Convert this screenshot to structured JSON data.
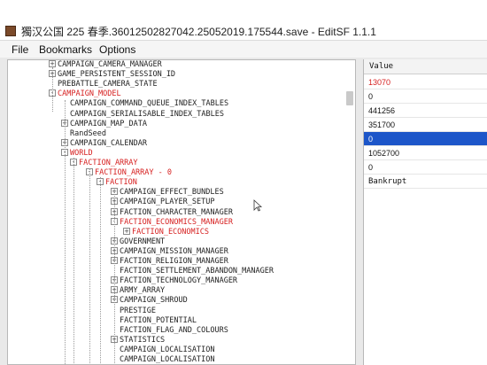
{
  "window": {
    "title": "獨汉公国 225 春季.36012502827042.25052019.175544.save - EditSF 1.1.1"
  },
  "menu": {
    "items": [
      "File",
      "Bookmarks",
      "Options"
    ]
  },
  "tree": {
    "rows": [
      {
        "label": "CAMPAIGN_CAMERA_MANAGER",
        "expander": "+",
        "red": false
      },
      {
        "label": "GAME_PERSISTENT_SESSION_ID",
        "expander": "+",
        "red": false
      },
      {
        "label": "PREBATTLE_CAMERA_STATE",
        "expander": "",
        "red": false
      },
      {
        "label": "CAMPAIGN_MODEL",
        "expander": "-",
        "red": true
      },
      {
        "label": "CAMPAIGN_COMMAND_QUEUE_INDEX_TABLES",
        "expander": "",
        "red": false
      },
      {
        "label": "CAMPAIGN_SERIALISABLE_INDEX_TABLES",
        "expander": "",
        "red": false
      },
      {
        "label": "CAMPAIGN_MAP_DATA",
        "expander": "+",
        "red": false
      },
      {
        "label": "RandSeed",
        "expander": "",
        "red": false
      },
      {
        "label": "CAMPAIGN_CALENDAR",
        "expander": "+",
        "red": false
      },
      {
        "label": "WORLD",
        "expander": "-",
        "red": true
      },
      {
        "label": "FACTION_ARRAY",
        "expander": "-",
        "red": true
      },
      {
        "label": "FACTION_ARRAY - 0",
        "expander": "-",
        "red": true
      },
      {
        "label": "FACTION",
        "expander": "-",
        "red": true
      },
      {
        "label": "CAMPAIGN_EFFECT_BUNDLES",
        "expander": "+",
        "red": false
      },
      {
        "label": "CAMPAIGN_PLAYER_SETUP",
        "expander": "+",
        "red": false
      },
      {
        "label": "FACTION_CHARACTER_MANAGER",
        "expander": "+",
        "red": false
      },
      {
        "label": "FACTION_ECONOMICS_MANAGER",
        "expander": "-",
        "red": true
      },
      {
        "label": "FACTION_ECONOMICS",
        "expander": "+",
        "red": true
      },
      {
        "label": "GOVERNMENT",
        "expander": "+",
        "red": false
      },
      {
        "label": "CAMPAIGN_MISSION_MANAGER",
        "expander": "+",
        "red": false
      },
      {
        "label": "FACTION_RELIGION_MANAGER",
        "expander": "+",
        "red": false
      },
      {
        "label": "FACTION_SETTLEMENT_ABANDON_MANAGER",
        "expander": "",
        "red": false
      },
      {
        "label": "FACTION_TECHNOLOGY_MANAGER",
        "expander": "+",
        "red": false
      },
      {
        "label": "ARMY_ARRAY",
        "expander": "+",
        "red": false
      },
      {
        "label": "CAMPAIGN_SHROUD",
        "expander": "+",
        "red": false
      },
      {
        "label": "PRESTIGE",
        "expander": "",
        "red": false
      },
      {
        "label": "FACTION_POTENTIAL",
        "expander": "",
        "red": false
      },
      {
        "label": "FACTION_FLAG_AND_COLOURS",
        "expander": "",
        "red": false
      },
      {
        "label": "STATISTICS",
        "expander": "+",
        "red": false
      },
      {
        "label": "CAMPAIGN_LOCALISATION",
        "expander": "",
        "red": false
      },
      {
        "label": "CAMPAIGN_LOCALISATION",
        "expander": "",
        "red": false
      }
    ]
  },
  "values": {
    "header": "Value",
    "rows": [
      {
        "text": "13070",
        "red": true,
        "selected": false,
        "mono": false
      },
      {
        "text": "0",
        "red": false,
        "selected": false,
        "mono": false
      },
      {
        "text": "441256",
        "red": false,
        "selected": false,
        "mono": false
      },
      {
        "text": "351700",
        "red": false,
        "selected": false,
        "mono": false
      },
      {
        "text": "0",
        "red": false,
        "selected": true,
        "mono": false
      },
      {
        "text": "1052700",
        "red": false,
        "selected": false,
        "mono": false
      },
      {
        "text": "0",
        "red": false,
        "selected": false,
        "mono": false
      },
      {
        "text": "Bankrupt",
        "red": false,
        "selected": false,
        "mono": true
      }
    ]
  },
  "colors": {
    "highlight": "#d62020",
    "selection": "#1d56c9"
  }
}
